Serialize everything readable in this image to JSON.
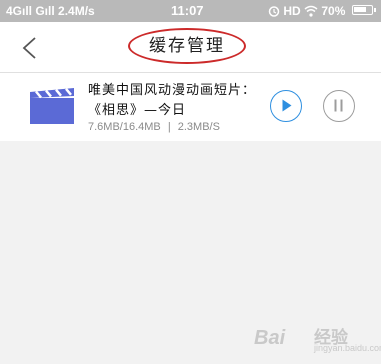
{
  "status_bar": {
    "left_text": "4Gıll Gıll 2.4M/s",
    "time": "11:07",
    "right_text": "HD",
    "battery": "70%",
    "battery_level": 0.7
  },
  "header": {
    "title": "缓存管理",
    "back_icon": "back-arrow-icon"
  },
  "downloads": [
    {
      "title": "唯美中国风动漫动画短片：《相思》—今日",
      "progress": "7.6MB/16.4MB",
      "speed": "2.3MB/S",
      "separator": "|",
      "progress_fraction": 0.463,
      "icon": "video-clapper-icon",
      "accent_color": "#5b6ad6"
    }
  ],
  "controls": {
    "play_icon": "play-icon",
    "pause_icon": "pause-icon",
    "play_color": "#2e8fe0",
    "pause_color": "#9c9c9c"
  },
  "watermark": {
    "logo": "Bai　",
    "text": "经验",
    "sub": "jingyan.baidu.com"
  }
}
